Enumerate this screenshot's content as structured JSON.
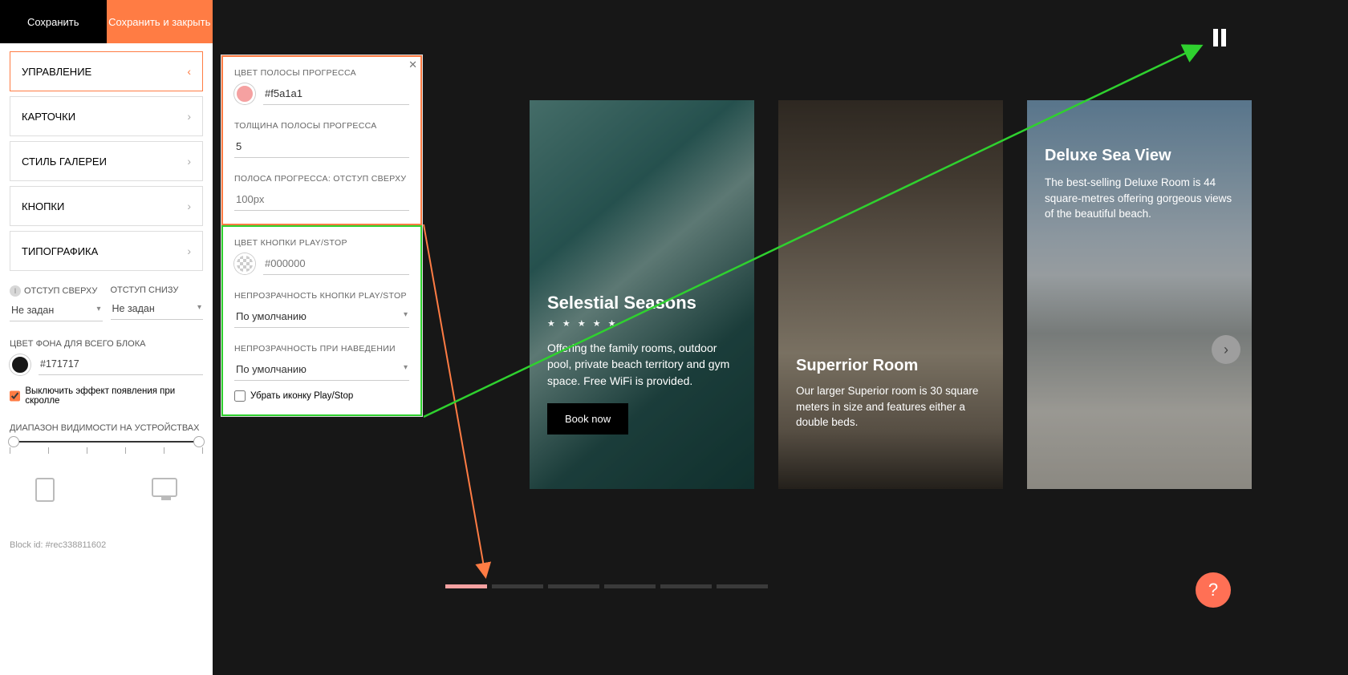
{
  "top": {
    "save": "Сохранить",
    "save_close": "Сохранить и закрыть"
  },
  "accordion": {
    "items": [
      {
        "label": "УПРАВЛЕНИЕ",
        "active": true
      },
      {
        "label": "КАРТОЧКИ"
      },
      {
        "label": "СТИЛЬ ГАЛЕРЕИ"
      },
      {
        "label": "КНОПКИ"
      },
      {
        "label": "ТИПОГРАФИКА"
      }
    ]
  },
  "fields": {
    "offset_top_label": "ОТСТУП СВЕРХУ",
    "offset_top_value": "Не задан",
    "offset_bottom_label": "ОТСТУП СНИЗУ",
    "offset_bottom_value": "Не задан",
    "bg_color_label": "ЦВЕТ ФОНА ДЛЯ ВСЕГО БЛОКА",
    "bg_color_value": "#171717",
    "scroll_checkbox": "Выключить эффект появления при скролле",
    "range_label": "ДИАПАЗОН ВИДИМОСТИ НА УСТРОЙСТВАХ"
  },
  "block_id": "Block id: #rec338811602",
  "panel2": {
    "progress_color_label": "ЦВЕТ ПОЛОСЫ ПРОГРЕССА",
    "progress_color_value": "#f5a1a1",
    "progress_thickness_label": "ТОЛЩИНА ПОЛОСЫ ПРОГРЕССА",
    "progress_thickness_value": "5",
    "progress_offset_label": "ПОЛОСА ПРОГРЕССА: ОТСТУП СВЕРХУ",
    "progress_offset_placeholder": "100px",
    "play_color_label": "ЦВЕТ КНОПКИ PLAY/STOP",
    "play_color_placeholder": "#000000",
    "play_opacity_label": "НЕПРОЗРАЧНОСТЬ КНОПКИ PLAY/STOP",
    "play_opacity_value": "По умолчанию",
    "hover_opacity_label": "НЕПРОЗРАЧНОСТЬ ПРИ НАВЕДЕНИИ",
    "hover_opacity_value": "По умолчанию",
    "remove_icon_label": "Убрать иконку Play/Stop"
  },
  "cards": [
    {
      "title": "Selestial Seasons",
      "stars": "★ ★ ★ ★ ★",
      "desc": "Offering the family rooms, outdoor pool, private beach territory and gym space. Free WiFi is provided.",
      "cta": "Book now"
    },
    {
      "title": "Superrior Room",
      "desc": "Our larger Superior room is 30 square meters in size and features either a double beds."
    },
    {
      "title": "Deluxe Sea View",
      "desc": "The best-selling Deluxe Room is 44 square-metres offering gorgeous views of the beautiful beach."
    }
  ],
  "colors": {
    "bg": "#171717",
    "accent": "#ff7c44",
    "progress": "#f5a1a1",
    "annotate_orange": "#ff7c44",
    "annotate_green": "#2fd12f"
  }
}
